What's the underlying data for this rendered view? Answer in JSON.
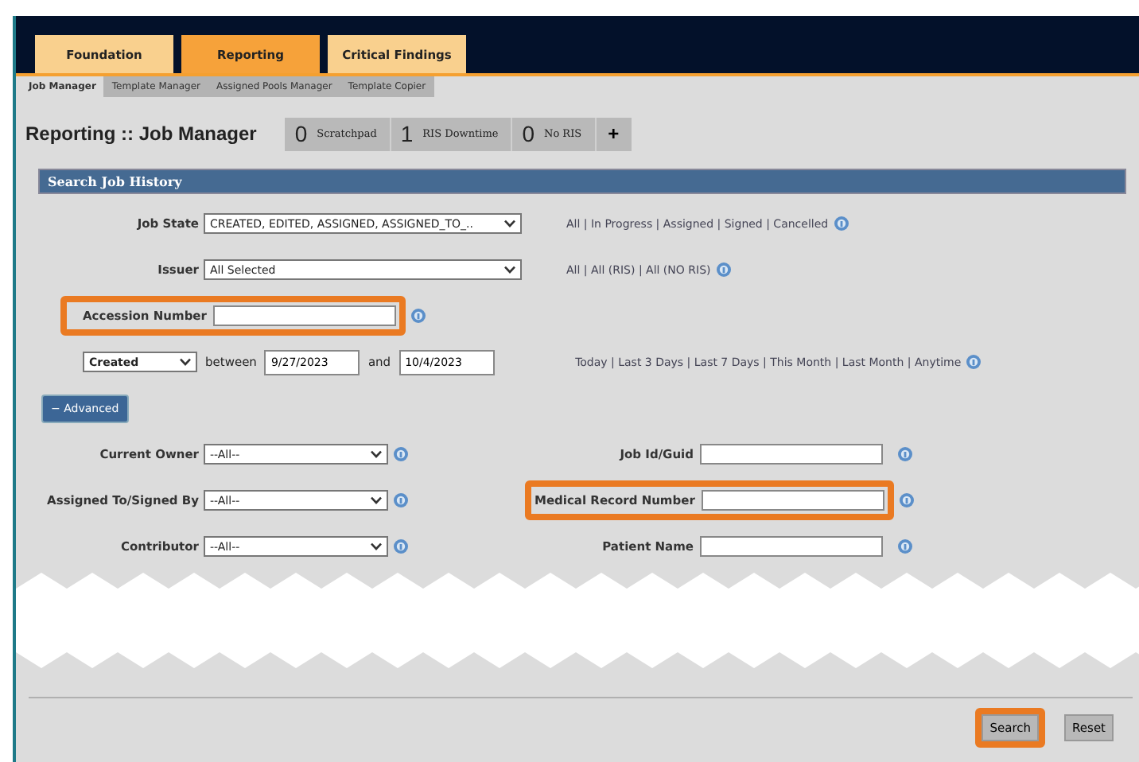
{
  "tabs": [
    {
      "label": "Foundation",
      "selected": false
    },
    {
      "label": "Reporting",
      "selected": true
    },
    {
      "label": "Critical Findings",
      "selected": false
    }
  ],
  "subtabs": [
    {
      "label": "Job Manager",
      "selected": true
    },
    {
      "label": "Template Manager",
      "selected": false
    },
    {
      "label": "Assigned Pools Manager",
      "selected": false
    },
    {
      "label": "Template Copier",
      "selected": false
    }
  ],
  "page_title": "Reporting :: Job Manager",
  "counters": [
    {
      "count": "0",
      "label": "Scratchpad"
    },
    {
      "count": "1",
      "label": "RIS Downtime"
    },
    {
      "count": "0",
      "label": "No RIS"
    }
  ],
  "add_button": "+",
  "section_title": "Search Job History",
  "job_state": {
    "label": "Job State",
    "value": "CREATED, EDITED, ASSIGNED, ASSIGNED_TO_..",
    "links": "All | In Progress | Assigned | Signed | Cancelled"
  },
  "issuer": {
    "label": "Issuer",
    "value": "All Selected",
    "links": "All | All (RIS) | All (NO RIS)"
  },
  "accession": {
    "label": "Accession Number",
    "highlighted": true
  },
  "date_range": {
    "field": "Created",
    "between": "between",
    "from": "9/27/2023",
    "and": "and",
    "to": "10/4/2023",
    "links": "Today | Last 3 Days | Last 7 Days | This Month | Last Month | Anytime"
  },
  "advanced_button": "− Advanced",
  "advanced_left": [
    {
      "label": "Current Owner",
      "value": "--All--"
    },
    {
      "label": "Assigned To/Signed By",
      "value": "--All--"
    },
    {
      "label": "Contributor",
      "value": "--All--"
    }
  ],
  "advanced_right": [
    {
      "label": "Job Id/Guid",
      "highlighted": false
    },
    {
      "label": "Medical Record Number",
      "highlighted": true
    },
    {
      "label": "Patient Name",
      "highlighted": false
    }
  ],
  "buttons": [
    {
      "label": "Search",
      "highlighted": true
    },
    {
      "label": "Reset",
      "highlighted": false
    }
  ]
}
